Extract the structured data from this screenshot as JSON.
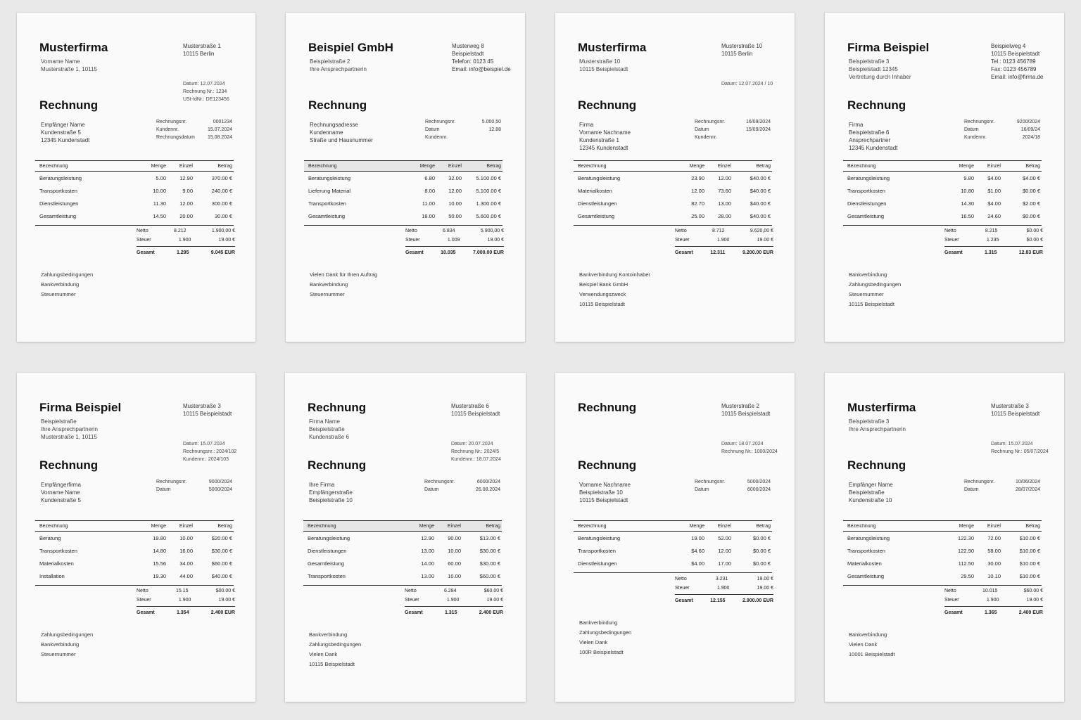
{
  "pages": [
    {
      "company": "Musterfirma",
      "subtitle": [
        "Vorname Name",
        "Musterstraße 1, 10115"
      ],
      "address": [
        "Musterstraße 1",
        "10115 Berlin"
      ],
      "meta": [
        "Datum: 12.07.2024",
        "Rechnung Nr.: 1234",
        "USt-IdNr.: DE123456"
      ],
      "heading": "Rechnung",
      "recipient": [
        "Empfänger Name",
        "Kundenstraße 5",
        "12345 Kundenstadt"
      ],
      "info": [
        [
          "Rechnungsnr.",
          "0001234"
        ],
        [
          "Kundennr.",
          "15.07.2024"
        ],
        [
          "Rechnungsdatum",
          "15.08.2024"
        ]
      ],
      "columns": [
        "Bezeichnung",
        "Menge",
        "Einzel",
        "Betrag"
      ],
      "rows": [
        [
          "Beratungsleistung",
          "5.00",
          "12.90",
          "370.00 €"
        ],
        [
          "Transportkosten",
          "10.00",
          "9.00",
          "240.00 €"
        ],
        [
          "Dienstleistungen",
          "11.30",
          "12.00",
          "300.00 €"
        ],
        [
          "Gesamtleistung",
          "14.50",
          "20.00",
          "30.00 €"
        ]
      ],
      "totals": [
        [
          "Netto",
          "8.212",
          "1.900,00 €"
        ],
        [
          "Steuer",
          "1.900",
          "19.00 €"
        ],
        [
          "Gesamt",
          "1.295",
          "9.045 EUR"
        ]
      ],
      "footer": [
        "Zahlungsbedingungen",
        "Bankverbindung",
        "Steuernummer"
      ]
    },
    {
      "company": "Beispiel GmbH",
      "subtitle": [
        "Beispielstraße 2",
        "Ihre Ansprechpartnerin"
      ],
      "address": [
        "Musterweg 8",
        "Beispielstadt",
        "Telefon: 0123 45",
        "Email: info@beispiel.de"
      ],
      "meta": [],
      "heading": "Rechnung",
      "recipient": [
        "Rechnungsadresse",
        "Kundenname",
        "Straße und Hausnummer"
      ],
      "info": [
        [
          "Rechnungsnr.",
          "5.000,50"
        ],
        [
          "Datum",
          "12.88"
        ],
        [
          "Kundennr.",
          ""
        ]
      ],
      "columns": [
        "Bezeichnung",
        "Menge",
        "Einzel",
        "Betrag"
      ],
      "rows": [
        [
          "Beratungsleistung",
          "6.80",
          "32.00",
          "5.100.00 €"
        ],
        [
          "Lieferung Material",
          "8.00",
          "12.00",
          "5.100.00 €"
        ],
        [
          "Transportkosten",
          "11.00",
          "10.00",
          "1.300.00 €"
        ],
        [
          "Gesamtleistung",
          "18.00",
          "50.00",
          "5.600.00 €"
        ]
      ],
      "totals": [
        [
          "Netto",
          "6.834",
          "5.900,00 €"
        ],
        [
          "Steuer",
          "1.009",
          "19.00 €"
        ],
        [
          "Gesamt",
          "10.035",
          "7.000.00 EUR"
        ]
      ],
      "footer": [
        "Vielen Dank für Ihren Auftrag",
        "Bankverbindung",
        "Steuernummer"
      ]
    },
    {
      "company": "Musterfirma",
      "subtitle": [
        "Musterstraße 10",
        "10115 Beispielstadt"
      ],
      "address": [
        "Musterstraße 10",
        "10115 Berlin"
      ],
      "meta": [
        "Datum: 12.07.2024 / 10"
      ],
      "heading": "Rechnung",
      "recipient": [
        "Firma",
        "Vorname Nachname",
        "Kundenstraße 1",
        "12345 Kundenstadt"
      ],
      "info": [
        [
          "Rechnungsnr.",
          "16/09/2024"
        ],
        [
          "Datum",
          "15/09/2024"
        ],
        [
          "Kundennr.",
          ""
        ]
      ],
      "columns": [
        "Bezeichnung",
        "Menge",
        "Einzel",
        "Betrag"
      ],
      "rows": [
        [
          "Beratungsleistung",
          "23.90",
          "12.00",
          "$40.00 €"
        ],
        [
          "Materialkosten",
          "12.00",
          "73.60",
          "$40.00 €"
        ],
        [
          "Dienstleistungen",
          "82.70",
          "13.00",
          "$40.00 €"
        ],
        [
          "Gesamtleistung",
          "25.00",
          "28.00",
          "$40.00 €"
        ]
      ],
      "totals": [
        [
          "Netto",
          "8.712",
          "9.620,00 €"
        ],
        [
          "Steuer",
          "1.900",
          "19.00 €"
        ],
        [
          "Gesamt",
          "12.311",
          "9.200.00 EUR"
        ]
      ],
      "footer": [
        "Bankverbindung Kontoinhaber",
        "Beispiel Bank GmbH",
        "Verwendungszweck",
        "10115 Beispielstadt"
      ]
    },
    {
      "company": "Firma Beispiel",
      "subtitle": [
        "Beispielstraße 3",
        "Beispielstadt 12345",
        "Vertretung durch Inhaber"
      ],
      "address": [
        "Beispielweg 4",
        "10115 Beispielstadt",
        "Tel.: 0123 456789",
        "Fax: 0123 456789",
        "Email: info@firma.de"
      ],
      "meta": [],
      "heading": "Rechnung",
      "recipient": [
        "Firma",
        "Beispielstraße 6",
        "Ansprechpartner",
        "12345 Kundenstadt"
      ],
      "info": [
        [
          "Rechnungsnr.",
          "9200/2024"
        ],
        [
          "Datum",
          "16/09/24"
        ],
        [
          "Kundennr.",
          "2024/18"
        ]
      ],
      "columns": [
        "Bezeichnung",
        "Menge",
        "Einzel",
        "Betrag"
      ],
      "rows": [
        [
          "Beratungsleistung",
          "9.80",
          "$4.00",
          "$4.00 €"
        ],
        [
          "Transportkosten",
          "10.80",
          "$1.00",
          "$0.00 €"
        ],
        [
          "Dienstleistungen",
          "14.30",
          "$4.00",
          "$2.00 €"
        ],
        [
          "Gesamtleistung",
          "16.50",
          "24.60",
          "$0.00 €"
        ]
      ],
      "totals": [
        [
          "Netto",
          "8.215",
          "$0.00 €"
        ],
        [
          "Steuer",
          "1.235",
          "$0.00 €"
        ],
        [
          "Gesamt",
          "1.315",
          "12.83 EUR"
        ]
      ],
      "footer": [
        "Bankverbindung",
        "Zahlungsbedingungen",
        "Steuernummer",
        "10115 Beispielstadt"
      ]
    },
    {
      "company": "Firma Beispiel",
      "subtitle": [
        "Beispielstraße",
        "Ihre Ansprechpartnerin",
        "Musterstraße 1, 10115"
      ],
      "address": [
        "Musterstraße 3",
        "10115 Beispielstadt"
      ],
      "meta": [
        "Datum: 15.07.2024",
        "Rechnungsnr.: 2024/102",
        "Kundennr.: 2024/103"
      ],
      "heading": "Rechnung",
      "recipient": [
        "Empfängerfirma",
        "Vorname Name",
        "Kundenstraße 5"
      ],
      "info": [
        [
          "Rechnungsnr.",
          "9000/2024"
        ],
        [
          "Datum",
          "5000/2024"
        ]
      ],
      "columns": [
        "Bezeichnung",
        "Menge",
        "Einzel",
        "Betrag"
      ],
      "rows": [
        [
          "Beratung",
          "19.80",
          "10.00",
          "$20.00 €"
        ],
        [
          "Transportkosten",
          "14.80",
          "16.00",
          "$30.00 €"
        ],
        [
          "Materialkosten",
          "15.56",
          "34.00",
          "$60.00 €"
        ],
        [
          "Installation",
          "19.30",
          "44.00",
          "$40.00 €"
        ]
      ],
      "totals": [
        [
          "Netto",
          "15.15",
          "$00.00 €"
        ],
        [
          "Steuer",
          "1.900",
          "19.00 €"
        ],
        [
          "Gesamt",
          "1.354",
          "2.400 EUR"
        ]
      ],
      "footer": [
        "Zahlungsbedingungen",
        "Bankverbindung",
        "Steuernummer"
      ]
    },
    {
      "company": "Rechnung",
      "subtitle": [
        "Firma Name",
        "Beispielstraße",
        "Kundenstraße 6"
      ],
      "address": [
        "Musterstraße 6",
        "10115 Beispielstadt"
      ],
      "meta": [
        "Datum: 20.07.2024",
        "Rechnung Nr.: 2024/5",
        "Kundennr.: 18.07.2024"
      ],
      "heading": "Rechnung",
      "recipient": [
        "Ihre Firma",
        "Empfängerstraße",
        "Beispielstraße 10"
      ],
      "info": [
        [
          "Rechnungsnr.",
          "6000/2024"
        ],
        [
          "Datum",
          "26.08.2024"
        ]
      ],
      "columns": [
        "Bezeichnung",
        "Menge",
        "Einzel",
        "Betrag"
      ],
      "rows": [
        [
          "Beratungsleistung",
          "12.90",
          "90.00",
          "$13.00 €"
        ],
        [
          "Dienstleistungen",
          "13.00",
          "10.00",
          "$30.00 €"
        ],
        [
          "Gesamtleistung",
          "14.00",
          "60.00",
          "$30.00 €"
        ],
        [
          "Transportkosten",
          "13.00",
          "10.00",
          "$60.00 €"
        ]
      ],
      "totals": [
        [
          "Netto",
          "6.284",
          "$60.00 €"
        ],
        [
          "Steuer",
          "1.900",
          "19.00 €"
        ],
        [
          "Gesamt",
          "1.315",
          "2.400 EUR"
        ]
      ],
      "footer": [
        "Bankverbindung",
        "Zahlungsbedingungen",
        "Vielen Dank",
        "10115 Beispielstadt"
      ]
    },
    {
      "company": "Rechnung",
      "subtitle": [],
      "address": [
        "Musterstraße 2",
        "10115 Beispielstadt"
      ],
      "meta": [
        "Datum: 18.07.2024",
        "Rechnung Nr.: 1000/2024"
      ],
      "heading": "Rechnung",
      "recipient": [
        "Vorname Nachname",
        "Beispielstraße 10",
        "10115 Beispielstadt"
      ],
      "info": [
        [
          "Rechnungsnr.",
          "5000/2024"
        ],
        [
          "Datum",
          "6000/2024"
        ]
      ],
      "columns": [
        "Bezeichnung",
        "Menge",
        "Einzel",
        "Betrag"
      ],
      "rows": [
        [
          "Beratungsleistung",
          "19.00",
          "52.00",
          "$0.00 €"
        ],
        [
          "Transportkosten",
          "$4.60",
          "12.00",
          "$0.00 €"
        ],
        [
          "Dienstleistungen",
          "$4.00",
          "17.00",
          "$0.00 €"
        ]
      ],
      "totals": [
        [
          "Netto",
          "3.231",
          "19.00 €"
        ],
        [
          "Steuer",
          "1.900",
          "19.00 €"
        ],
        [
          "Gesamt",
          "12.155",
          "2.900.00 EUR"
        ]
      ],
      "footer": [
        "Bankverbindung",
        "Zahlungsbedingungen",
        "Vielen Dank",
        "100R Beispielstadt"
      ]
    },
    {
      "company": "Musterfirma",
      "subtitle": [
        "Beispielstraße 3",
        "Ihre Ansprechpartnerin"
      ],
      "address": [
        "Musterstraße 3",
        "10115 Beispielstadt"
      ],
      "meta": [
        "Datum: 15.07.2024",
        "Rechnung Nr.: 05/07/2024"
      ],
      "heading": "Rechnung",
      "recipient": [
        "Empfänger Name",
        "Beispielstraße",
        "Kundenstraße 10"
      ],
      "info": [
        [
          "Rechnungsnr.",
          "10/06/2024"
        ],
        [
          "Datum",
          "28/07/2024"
        ]
      ],
      "columns": [
        "Bezeichnung",
        "Menge",
        "Einzel",
        "Betrag"
      ],
      "rows": [
        [
          "Beratungsleistung",
          "122.30",
          "72.00",
          "$10.00 €"
        ],
        [
          "Transportkosten",
          "122.90",
          "58.00",
          "$10.00 €"
        ],
        [
          "Materialkosten",
          "112.50",
          "30.00",
          "$10.00 €"
        ],
        [
          "Gesamtleistung",
          "29.50",
          "10.10",
          "$10.00 €"
        ]
      ],
      "totals": [
        [
          "Netto",
          "10.015",
          "$60.00 €"
        ],
        [
          "Steuer",
          "1.900",
          "19.00 €"
        ],
        [
          "Gesamt",
          "1.365",
          "2.400 EUR"
        ]
      ],
      "footer": [
        "Bankverbindung",
        "Vielen Dank",
        "10001 Beispielstadt"
      ]
    }
  ]
}
